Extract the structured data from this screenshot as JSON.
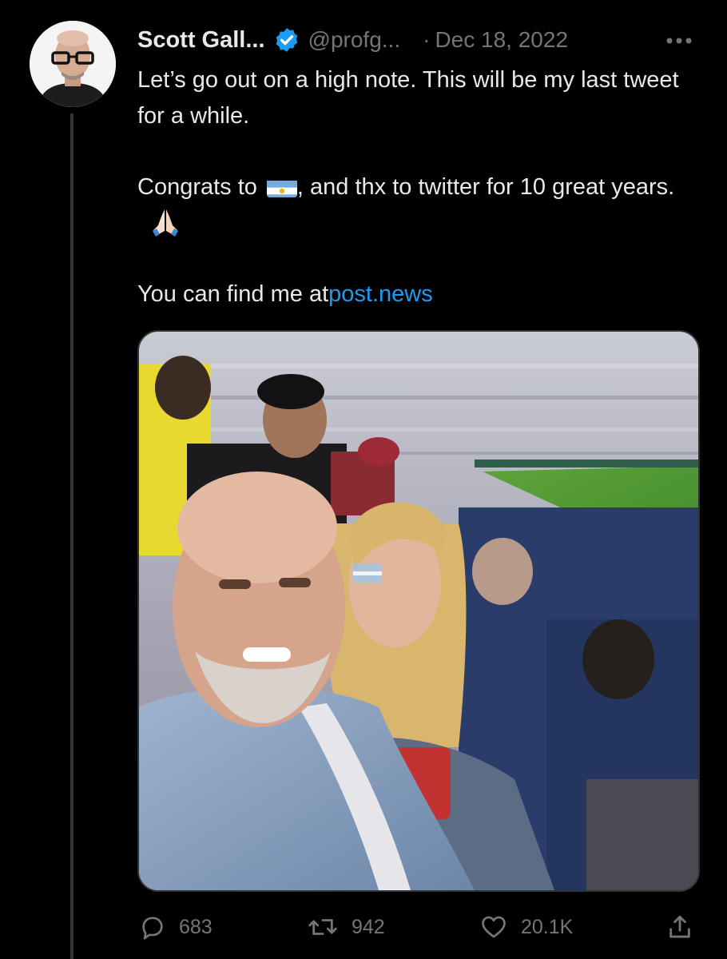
{
  "tweet": {
    "author": {
      "display_name": "Scott Gall...",
      "handle": "@profg...",
      "verified": true,
      "avatar_icon": "avatar-photo"
    },
    "separator": "·",
    "date": "Dec 18, 2022",
    "text": {
      "line1": "Let’s go out on a high note.  This will be my last tweet for a while.",
      "line2_before_flag": "Congrats to",
      "line2_after_flag": ", and thx to twitter for 10 great years.",
      "line3_before_link": "You can find me at",
      "link": "post.news"
    },
    "emoji": [
      "argentina-flag-icon",
      "folded-hands-icon"
    ],
    "media": {
      "type": "photo",
      "icon": "photo"
    },
    "stats": {
      "replies": "683",
      "retweets": "942",
      "likes": "20.1K"
    }
  },
  "colors": {
    "background": "#000000",
    "text": "#e7e9ea",
    "secondary": "#71767b",
    "link": "#1d9bf0",
    "verified": "#1d9bf0",
    "thread_line": "#333639"
  },
  "icons": {
    "more": "more-horizontal-icon",
    "reply": "reply-bubble-icon",
    "retweet": "retweet-arrows-icon",
    "like": "heart-icon",
    "share": "share-upload-icon"
  }
}
